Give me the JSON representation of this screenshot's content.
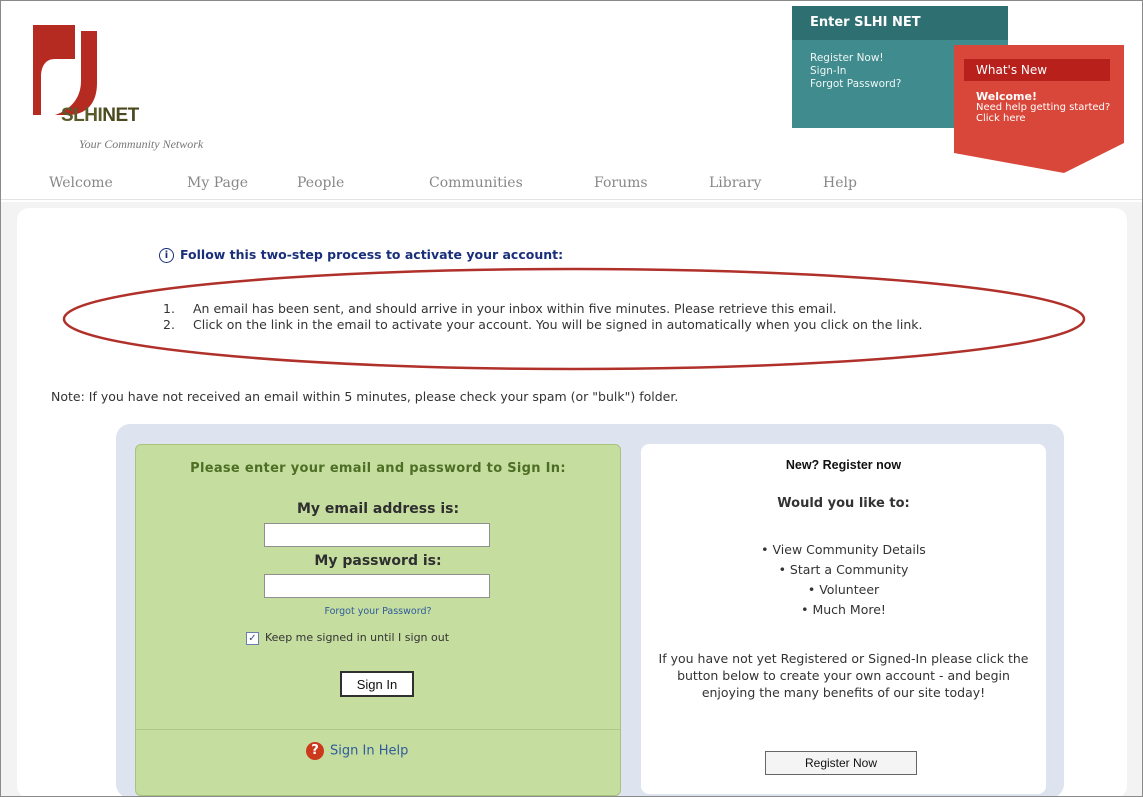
{
  "brand": {
    "name_part1": "SLHI",
    "name_part2": "NET",
    "tagline": "Your Community Network",
    "accent_red": "#c0392b",
    "accent_teal": "#3f8b8d"
  },
  "enter_box": {
    "title": "Enter SLHI NET",
    "links": [
      "Register Now!",
      "Sign-In",
      "Forgot Password?"
    ]
  },
  "whats_new": {
    "title": "What's New",
    "welcome": "Welcome!",
    "text": "Need help getting started? Click here"
  },
  "nav": [
    "Welcome",
    "My Page",
    "People",
    "Communities",
    "Forums",
    "Library",
    "Help"
  ],
  "activation": {
    "heading": "Follow this two-step process to activate your account:",
    "steps": [
      {
        "num": "1.",
        "text": "An email has been sent, and should arrive in your inbox within five minutes. Please retrieve this email."
      },
      {
        "num": "2.",
        "text": "Click on the link in the email to activate your account. You will be signed in automatically when you click on the link."
      }
    ],
    "note": "Note: If you have not received an email within 5 minutes, please check your spam (or \"bulk\") folder."
  },
  "signin": {
    "title": "Please enter your email and password to Sign In:",
    "email_label": "My email address is:",
    "email_value": "",
    "password_label": "My password is:",
    "password_value": "",
    "forgot": "Forgot your Password?",
    "keep_signed": "Keep me signed in until I sign out",
    "keep_checked": "true",
    "button": "Sign In",
    "help": "Sign In Help"
  },
  "register": {
    "title": "New? Register now",
    "subtitle": "Would you like to:",
    "items": [
      "View Community Details",
      "Start a Community",
      "Volunteer",
      "Much More!"
    ],
    "text": "If you have not yet Registered or Signed-In please click the button below to create your own account - and begin enjoying the many benefits of our site today!",
    "button": "Register Now"
  }
}
